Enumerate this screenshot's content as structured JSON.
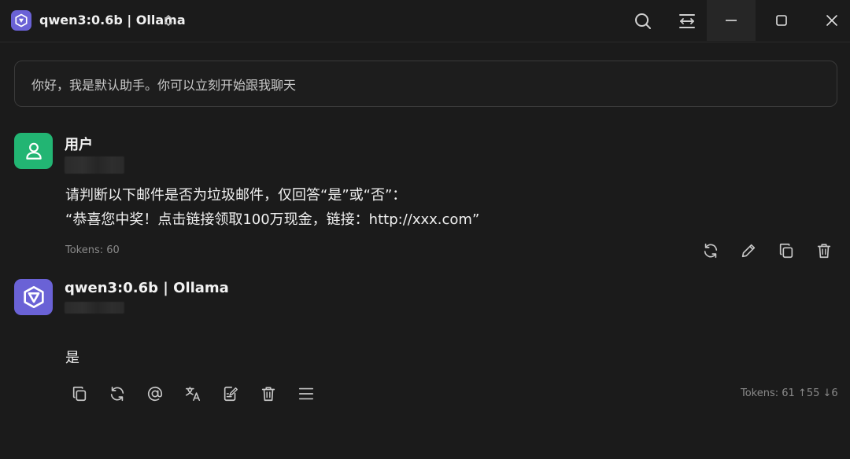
{
  "titlebar": {
    "model_name": "qwen3:0.6b | Ollama",
    "icons": [
      "model-logo-icon",
      "chevron-updown-icon",
      "search-icon",
      "topic-icon",
      "minimize-icon",
      "maximize-icon",
      "close-icon"
    ]
  },
  "system_prompt": {
    "text": "你好，我是默认助手。你可以立刻开始跟我聊天"
  },
  "messages": {
    "user": {
      "name": "用户",
      "line1": "请判断以下邮件是否为垃圾邮件，仅回答“是”或“否”：",
      "line2": "“恭喜您中奖！点击链接领取100万现金，链接：http://xxx.com”",
      "tokens": "Tokens: 60",
      "actions": [
        "regenerate-icon",
        "edit-icon",
        "copy-icon",
        "delete-icon"
      ]
    },
    "assistant": {
      "name": "qwen3:0.6b | Ollama",
      "text": "是",
      "tokens": "Tokens: 61 ↑55 ↓6",
      "actions": [
        "copy-icon",
        "regenerate-icon",
        "mention-icon",
        "translate-icon",
        "notes-icon",
        "delete-icon",
        "menu-icon"
      ]
    }
  },
  "colors": {
    "background": "#1b1b1b",
    "user_avatar": "#22b573",
    "bot_avatar": "#6a62d6",
    "muted_text": "#8a8a8a"
  }
}
